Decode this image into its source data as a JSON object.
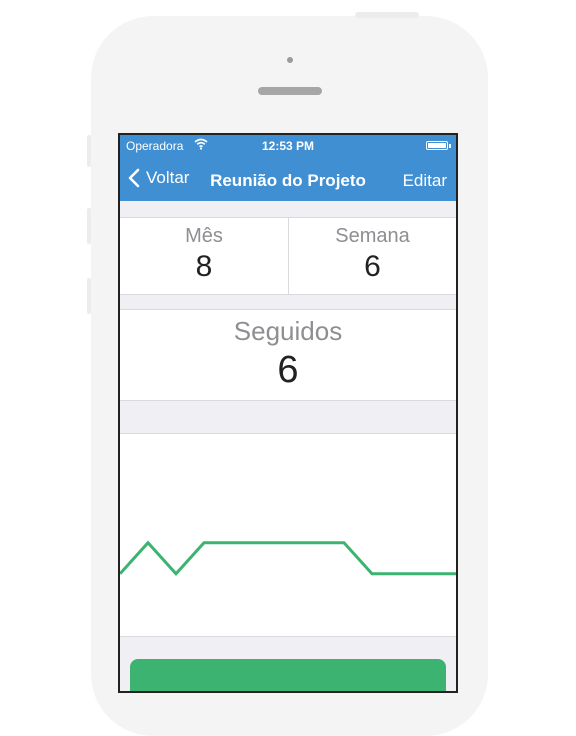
{
  "status_bar": {
    "carrier": "Operadora",
    "time": "12:53 PM"
  },
  "nav_bar": {
    "back_label": "Voltar",
    "title": "Reunião do Projeto",
    "edit_label": "Editar"
  },
  "stats": {
    "month": {
      "label": "Mês",
      "value": "8"
    },
    "week": {
      "label": "Semana",
      "value": "6"
    },
    "streak": {
      "label": "Seguidos",
      "value": "6"
    }
  },
  "colors": {
    "accent": "#3f8fd2",
    "chart_line": "#3cb370",
    "button": "#3cb370"
  },
  "chart_data": {
    "type": "line",
    "x": [
      0,
      1,
      2,
      3,
      4,
      5,
      6,
      7,
      8,
      9,
      10,
      11,
      12
    ],
    "series": [
      {
        "values": [
          2,
          3,
          2,
          3,
          3,
          3,
          3,
          3,
          3,
          2,
          2,
          2,
          2
        ]
      }
    ],
    "ylim": [
      0,
      6.5
    ],
    "grid": false,
    "xlabel": "",
    "ylabel": ""
  }
}
